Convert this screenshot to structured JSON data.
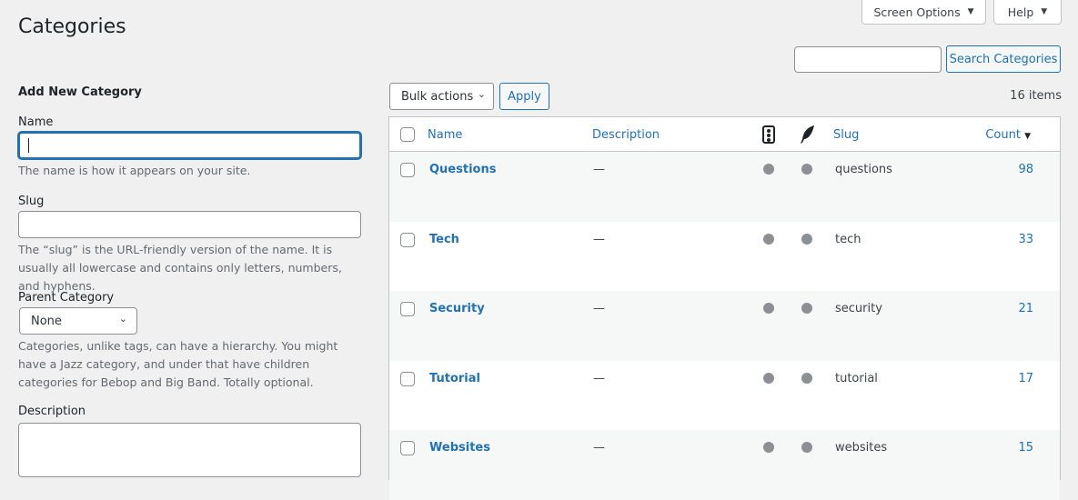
{
  "header": {
    "title": "Categories",
    "screen_options": "Screen Options",
    "help": "Help",
    "search_button": "Search Categories",
    "search_value": ""
  },
  "form": {
    "heading": "Add New Category",
    "name_label": "Name",
    "name_value": "",
    "name_help": "The name is how it appears on your site.",
    "slug_label": "Slug",
    "slug_help": "The “slug” is the URL-friendly version of the name. It is usually all lowercase and contains only letters, numbers, and hyphens.",
    "parent_label": "Parent Category",
    "parent_value": "None",
    "parent_help": "Categories, unlike tags, can have a hierarchy. You might have a Jazz category, and under that have children categories for Bebop and Big Band. Totally optional.",
    "description_label": "Description"
  },
  "list": {
    "bulk_actions": "Bulk actions",
    "apply": "Apply",
    "items_count": "16 items",
    "columns": {
      "name": "Name",
      "description": "Description",
      "col_icon1": "traffic-light-icon",
      "col_icon2": "feather-icon",
      "slug": "Slug",
      "count": "Count"
    },
    "rows": [
      {
        "name": "Questions",
        "description": "—",
        "slug": "questions",
        "count": "98"
      },
      {
        "name": "Tech",
        "description": "—",
        "slug": "tech",
        "count": "33"
      },
      {
        "name": "Security",
        "description": "—",
        "slug": "security",
        "count": "21"
      },
      {
        "name": "Tutorial",
        "description": "—",
        "slug": "tutorial",
        "count": "17"
      },
      {
        "name": "Websites",
        "description": "—",
        "slug": "websites",
        "count": "15"
      }
    ]
  }
}
